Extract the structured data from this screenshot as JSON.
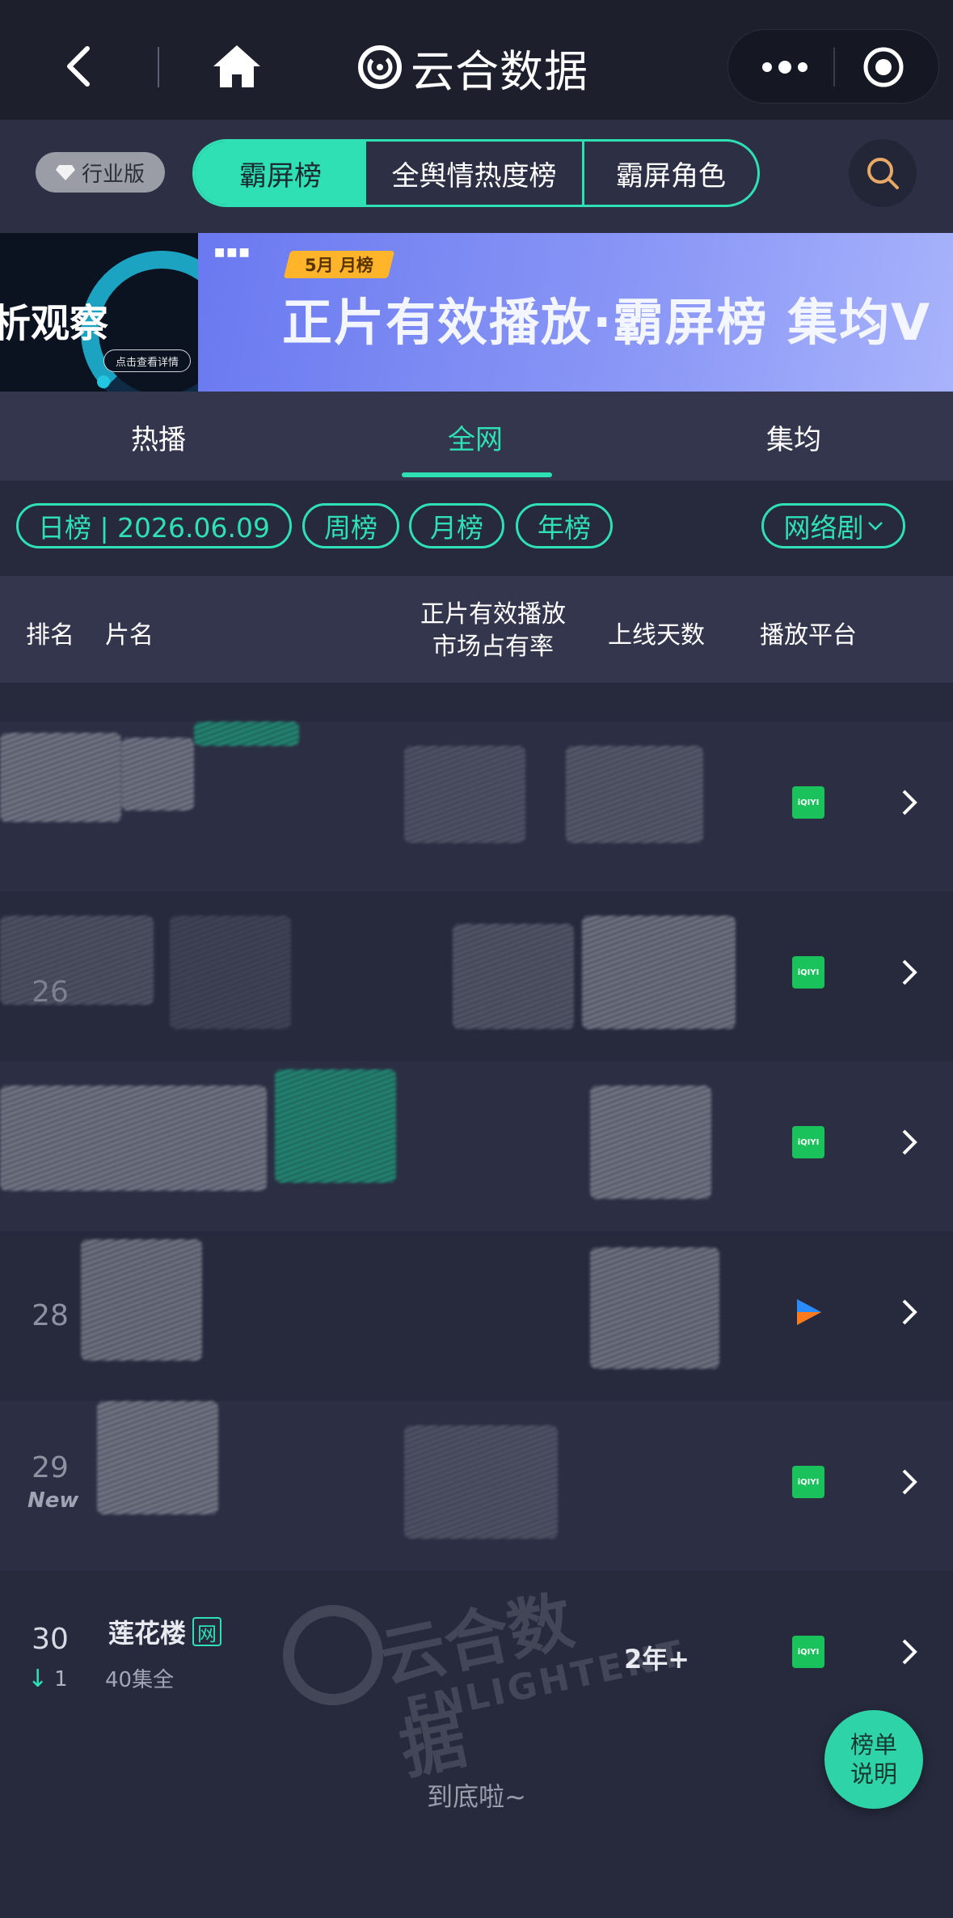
{
  "nav": {
    "brand": "云合数据"
  },
  "toolbar": {
    "edition_label": "行业版",
    "segments": [
      "霸屏榜",
      "全舆情热度榜",
      "霸屏角色"
    ]
  },
  "banner": {
    "left_text": "析观察",
    "left_button": "点击查看详情",
    "tag": "5月 月榜",
    "headline": "正片有效播放·霸屏榜 集均V"
  },
  "tabs": [
    "热播",
    "全网",
    "集均"
  ],
  "filters": {
    "date_pill": "日榜 | 2026.06.09",
    "week": "周榜",
    "month": "月榜",
    "year": "年榜",
    "category": "网络剧"
  },
  "table_header": {
    "rank": "排名",
    "title": "片名",
    "share_line1": "正片有效播放",
    "share_line2": "市场占有率",
    "days": "上线天数",
    "platform": "播放平台"
  },
  "rows": [
    {
      "rank": "",
      "platform": "iqiyi-icon"
    },
    {
      "rank": "26",
      "platform": "iqiyi-icon"
    },
    {
      "rank": "",
      "platform": "iqiyi-icon"
    },
    {
      "rank": "28",
      "platform": "tencent-video-icon"
    },
    {
      "rank": "29",
      "new_label": "New",
      "platform": "iqiyi-icon"
    },
    {
      "rank": "30",
      "trend": "1",
      "title": "莲花楼",
      "badge": "网",
      "episodes": "40集全",
      "days": "2年+",
      "platform": "iqiyi-icon"
    }
  ],
  "platform_text": {
    "iqiyi": "iQIYI"
  },
  "footer": {
    "end_text": "到底啦~",
    "fab_line1": "榜单",
    "fab_line2": "说明"
  },
  "watermark": {
    "cn": "云合数据",
    "en": "ENLIGHTENT"
  },
  "colors": {
    "accent": "#2ee0b3",
    "background": "#272a3d",
    "iqiyi": "#19c25a"
  }
}
